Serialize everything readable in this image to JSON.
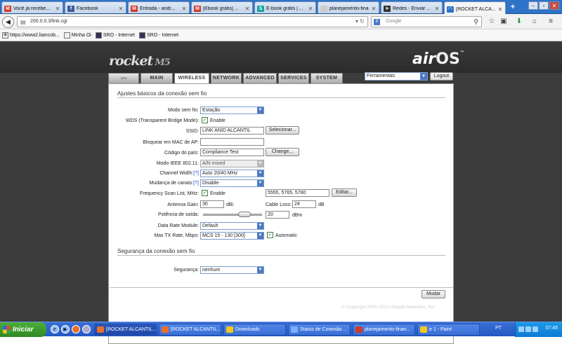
{
  "browser": {
    "tabs": [
      {
        "label": "Você já recebe...",
        "icon": "gmail-icon",
        "color": "#d23a2a"
      },
      {
        "label": "Facebook",
        "icon": "facebook-icon",
        "color": "#3b5998"
      },
      {
        "label": "Entrada - andr...",
        "icon": "gmail-icon",
        "color": "#d23a2a"
      },
      {
        "label": "[Ebook grátis] ...",
        "icon": "gmail-icon",
        "color": "#d23a2a"
      },
      {
        "label": "E-book grátis | ...",
        "icon": "scribd-icon",
        "color": "#1aa0a0"
      },
      {
        "label": "planejamento-finan...",
        "icon": "page-icon",
        "color": "#888888"
      },
      {
        "label": "Redes - Enviar ...",
        "icon": "cursor-icon",
        "color": "#333333"
      },
      {
        "label": "[ROCKET ALCA...",
        "icon": "wifi-icon",
        "color": "#2f73c8"
      }
    ],
    "new_tab": "+",
    "url": "200.0.0.3/link.cgi",
    "search_placeholder": "Google",
    "bookmarks": [
      {
        "label": "https://www2.bancob..."
      },
      {
        "label": "Minha Oi"
      },
      {
        "label": "SRO - Internet"
      },
      {
        "label": "SRO - Internet"
      }
    ]
  },
  "header": {
    "logo": "rocket",
    "logo_model": "M5",
    "brand_air": "air",
    "brand_os": "OS",
    "brand_tm": "™",
    "tabs": [
      "MAIN",
      "WIRELESS",
      "NETWORK",
      "ADVANCED",
      "SERVICES",
      "SYSTEM"
    ],
    "active_tab": "WIRELESS",
    "tools_label": "Ferramentas:",
    "logout_label": "Logout"
  },
  "wireless": {
    "section_title": "Ajustes básicos da conexão sem fio",
    "fields": {
      "mode_label": "Modo sem fio:",
      "mode_value": "Estação",
      "wds_label": "WDS (Transparent Bridge Mode):",
      "wds_enable": "Enable",
      "ssid_label": "SSID:",
      "ssid_value": "LINK ANID ALCANTIL",
      "select_button": "Selecionar...",
      "lock_mac_label": "Bloquear em MAC de AP:",
      "lock_mac_value": "",
      "country_label": "Código do país:",
      "country_value": "Compliance Test",
      "change_button": "Change...",
      "ieee_label": "Modo IEEE 802.11:",
      "ieee_value": "A/N mixed",
      "channel_width_label": "Channel Width:",
      "channel_width_value": "Auto 20/40 MHz",
      "channel_change_label": "Mudança de canais:",
      "channel_change_value": "Disable",
      "help_mark": "[?]",
      "freq_label": "Frequency Scan List, MHz:",
      "freq_enable": "Enable",
      "freq_value": "5555, 5765, 5780",
      "edit_button": "Editar...",
      "antenna_label": "Antenna Gain:",
      "antenna_value": "30",
      "antenna_unit": "dBi",
      "cable_label": "Cable Loss:",
      "cable_value": "24",
      "cable_unit": "dB",
      "power_label": "Potência de saída:",
      "power_value": "20",
      "power_unit": "dBm",
      "data_rate_label": "Data Rate Module:",
      "data_rate_value": "Default",
      "max_tx_label": "Max TX Rate, Mbps:",
      "max_tx_value": "MCS 15 - 130 [300]",
      "automatic": "Automatic"
    },
    "slider_fraction": 0.75
  },
  "security": {
    "section_title": "Segurança da conexão sem fio",
    "label": "Segurança:",
    "value": "nenhum"
  },
  "footer": {
    "apply_button": "Mudar",
    "copyright": "© Copyright 2006-2013 Ubiquiti Networks, Inc."
  },
  "taskbar": {
    "start": "Iniciar",
    "items": [
      {
        "label": "[ROCKET ALCANTIL...",
        "color": "#e8702a"
      },
      {
        "label": "[ROCKET ALCANTIL...",
        "color": "#e8702a"
      },
      {
        "label": "Downloads",
        "color": "#f2c81a"
      },
      {
        "label": "Status de Conexão ...",
        "color": "#7ab0ff"
      },
      {
        "label": "planejamento-finan...",
        "color": "#d23a2a"
      },
      {
        "label": "e 1 - Paint",
        "color": "#f2c81a"
      }
    ],
    "lang": "PT",
    "clock": "07:45"
  }
}
